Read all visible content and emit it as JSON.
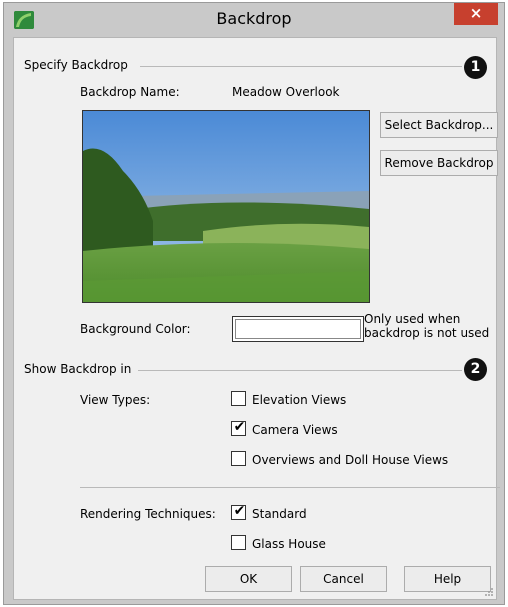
{
  "window": {
    "title": "Backdrop",
    "close_label": "×"
  },
  "specify": {
    "section_label": "Specify Backdrop",
    "badge": "1",
    "name_label": "Backdrop Name:",
    "name_value": "Meadow Overlook",
    "select_button": "Select Backdrop...",
    "remove_button": "Remove Backdrop",
    "background_color_label": "Background Color:",
    "background_color_value": "#ffffff",
    "note_line1": "Only used when",
    "note_line2": "backdrop is not used"
  },
  "show": {
    "section_label": "Show Backdrop in",
    "badge": "2",
    "view_types_label": "View Types:",
    "view_types": [
      {
        "label": "Elevation Views",
        "checked": false
      },
      {
        "label": "Camera Views",
        "checked": true
      },
      {
        "label": "Overviews and Doll House Views",
        "checked": false
      }
    ],
    "rendering_label": "Rendering Techniques:",
    "rendering": [
      {
        "label": "Standard",
        "checked": true
      },
      {
        "label": "Glass House",
        "checked": false
      }
    ]
  },
  "buttons": {
    "ok": "OK",
    "cancel": "Cancel",
    "help": "Help"
  },
  "colors": {
    "close": "#c7402e",
    "titlebar": "#c9c9c9",
    "client": "#f0f0f0",
    "app_icon": "#2f8a3c"
  },
  "icons": {
    "app": "chief-architect-app-icon",
    "close": "close-icon",
    "resize": "resize-grip-icon"
  }
}
